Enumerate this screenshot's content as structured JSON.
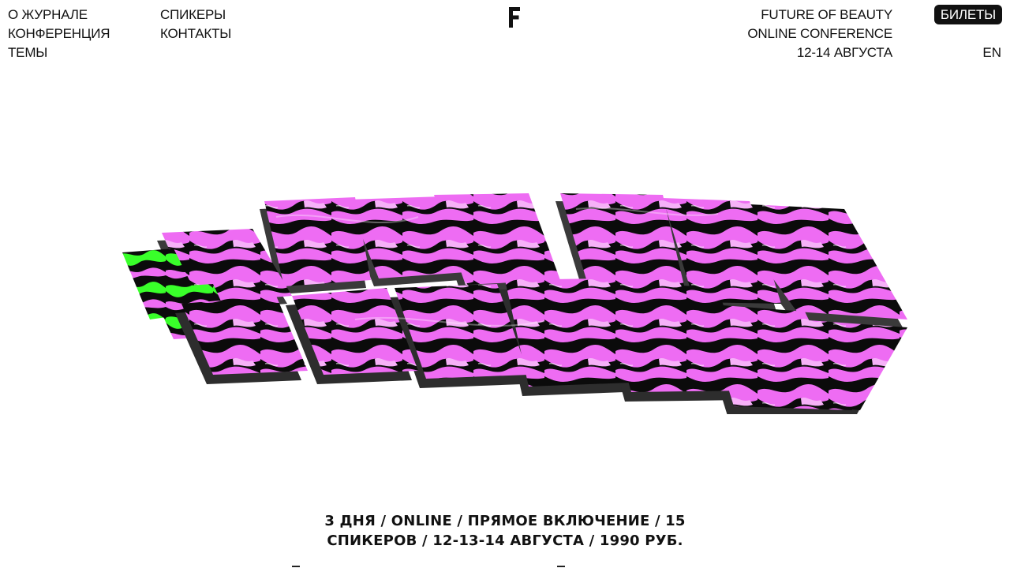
{
  "nav": {
    "col1": [
      {
        "label": "О ЖУРНАЛЕ"
      },
      {
        "label": "КОНФЕРЕНЦИЯ"
      },
      {
        "label": "ТЕМЫ"
      }
    ],
    "col2": [
      {
        "label": "СПИКЕРЫ"
      },
      {
        "label": "КОНТАКТЫ"
      }
    ]
  },
  "logo": {
    "icon": "f-logo-icon",
    "letter": "F"
  },
  "event": {
    "line1": "FUTURE OF BEAUTY",
    "line2": "ONLINE CONFERENCE",
    "line3": "12-14 АВГУСТА"
  },
  "tickets_label": "БИЛЕТЫ",
  "lang_label": "EN",
  "hero": {
    "icon": "future-of-beauty-3d-logo",
    "colors": {
      "black": "#0b0b0b",
      "pink": "#ee6cf3",
      "green": "#39ff2a",
      "grey": "#6e6e6e"
    }
  },
  "summary": {
    "line1": "3 ДНЯ / ONLINE / ПРЯМОЕ ВКЛЮЧЕНИЕ / 15",
    "line2": "СПИКЕРОВ / 12-13-14 АВГУСТА / 1990 РУБ."
  },
  "colors": {
    "text": "#111111",
    "background": "#ffffff",
    "button": "#111111"
  }
}
